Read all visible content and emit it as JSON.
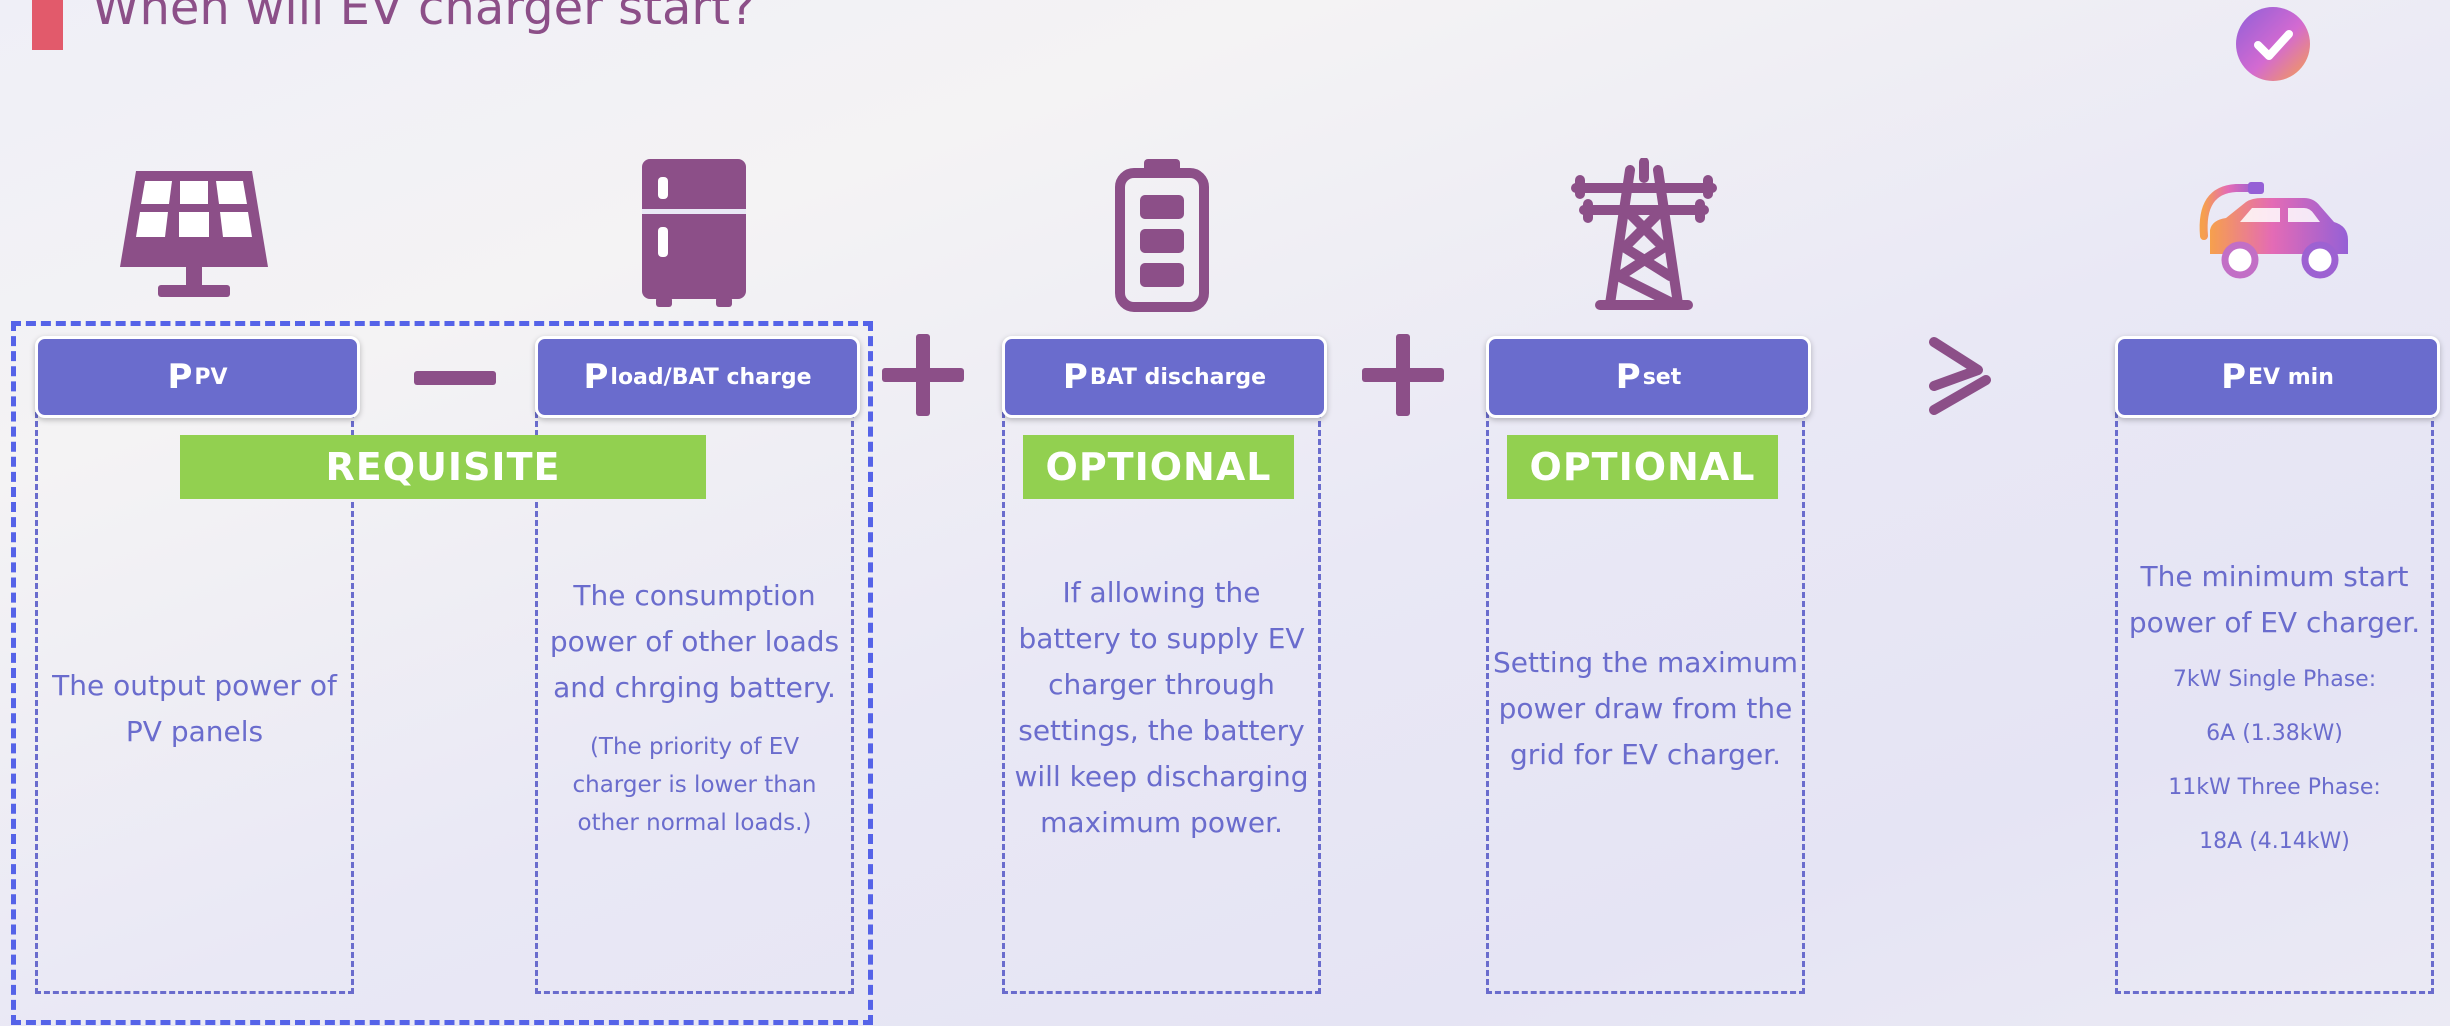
{
  "title": "When will EV charger start?",
  "headers": {
    "pv": {
      "main": "P",
      "sub": "PV"
    },
    "load": {
      "main": "P",
      "sub": "load/BAT charge"
    },
    "bat": {
      "main": "P",
      "sub": "BAT discharge"
    },
    "set": {
      "main": "P",
      "sub": "set"
    },
    "ev": {
      "main": "P",
      "sub": "EV min"
    }
  },
  "badges": {
    "requisite": "REQUISITE",
    "optional_bat": "OPTIONAL",
    "optional_set": "OPTIONAL"
  },
  "descriptions": {
    "pv": [
      "The output power of",
      "PV panels"
    ],
    "load": [
      "The consumption",
      "power of other loads",
      "and chrging battery."
    ],
    "load_note": [
      "(The priority of EV",
      "charger is lower than",
      "other normal loads.)"
    ],
    "bat": [
      "If allowing the",
      "battery to supply EV",
      "charger through",
      "settings, the battery",
      "will keep discharging",
      "maximum power."
    ],
    "set": [
      "Setting the maximum",
      "power draw from the",
      "grid for EV charger."
    ],
    "ev": [
      "The minimum start",
      "power of EV charger."
    ],
    "ev_specs": [
      "7kW Single Phase:",
      "6A (1.38kW)",
      "11kW Three Phase:",
      "18A (4.14kW)"
    ]
  },
  "icons": {
    "title_marker": "red-bar",
    "check": "check-circle-icon",
    "pv": "solar-panel-icon",
    "load": "refrigerator-icon",
    "bat": "battery-icon",
    "set": "power-tower-icon",
    "ev": "ev-car-icon"
  },
  "colors": {
    "title": "#8c4f88",
    "icon": "#8c4f88",
    "header_fill": "#6a6ccd",
    "badge": "#92d050",
    "text": "#6a6ccd",
    "group_border": "#5563e8",
    "title_marker": "#e25a6b"
  }
}
